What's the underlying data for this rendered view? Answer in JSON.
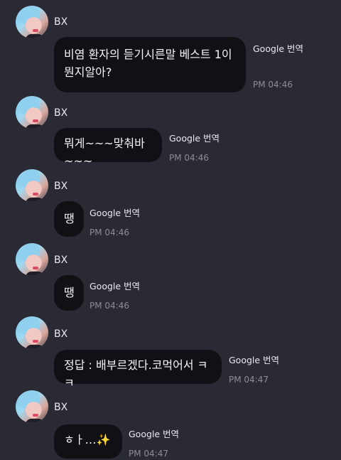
{
  "messages": [
    {
      "sender": "BX",
      "text": "비염 환자의 듣기시른말 베스트 1이 뭔지알아?",
      "translate": "Google 번역",
      "time": "PM 04:46"
    },
    {
      "sender": "BX",
      "text": "뭐게~~~맞춰바~~~",
      "translate": "Google 번역",
      "time": "PM 04:46"
    },
    {
      "sender": "BX",
      "text": "땡",
      "translate": "Google 번역",
      "time": "PM 04:46"
    },
    {
      "sender": "BX",
      "text": "땡",
      "translate": "Google 번역",
      "time": "PM 04:46"
    },
    {
      "sender": "BX",
      "text": "정답 : 배부르겠다.코먹어서 ㅋㅋ",
      "translate": "Google 번역",
      "time": "PM 04:47"
    },
    {
      "sender": "BX",
      "text": "ㅎㅏ…",
      "emoji": "✨",
      "translate": "Google 번역",
      "time": "PM 04:47"
    }
  ]
}
